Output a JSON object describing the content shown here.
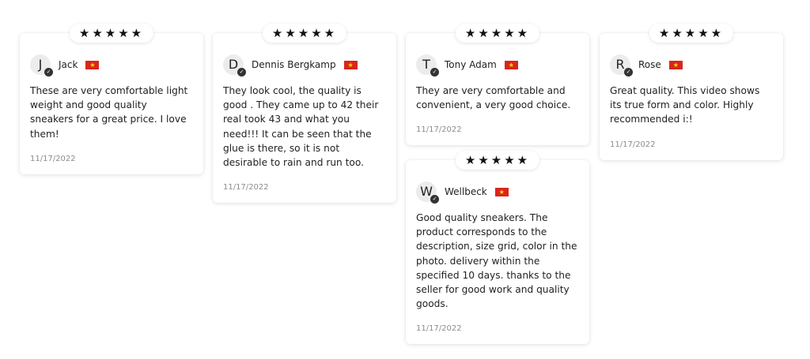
{
  "star_glyphs": "★★★★★",
  "reviews": [
    {
      "initial": "J",
      "name": "Jack",
      "text": "These are very comfortable light weight and good quality sneakers for a great price. I love them!",
      "date": "11/17/2022",
      "rating": 5
    },
    {
      "initial": "D",
      "name": "Dennis Bergkamp",
      "text": "They look cool, the quality is good . They came up to 42 their real took 43 and what you need!!! It can be seen that the glue is there, so it is not desirable to rain and run too.",
      "date": "11/17/2022",
      "rating": 5
    },
    {
      "initial": "T",
      "name": "Tony Adam",
      "text": "They are very comfortable and convenient, a very good choice.",
      "date": "11/17/2022",
      "rating": 5
    },
    {
      "initial": "W",
      "name": "Wellbeck",
      "text": "Good quality sneakers. The product corresponds to the description, size grid, color in the photo. delivery within the specified 10 days. thanks to the seller for good work and quality goods.",
      "date": "11/17/2022",
      "rating": 5
    },
    {
      "initial": "R",
      "name": "Rose",
      "text": "Great quality. This video shows its true form and color. Highly recommended i:!",
      "date": "11/17/2022",
      "rating": 5
    }
  ],
  "icons": {
    "verified": "check-circle-icon",
    "flag": "vietnam-flag-icon"
  },
  "colors": {
    "flag_red": "#da251d",
    "flag_star": "#ffde00",
    "date_gray": "#8c8c8c"
  }
}
